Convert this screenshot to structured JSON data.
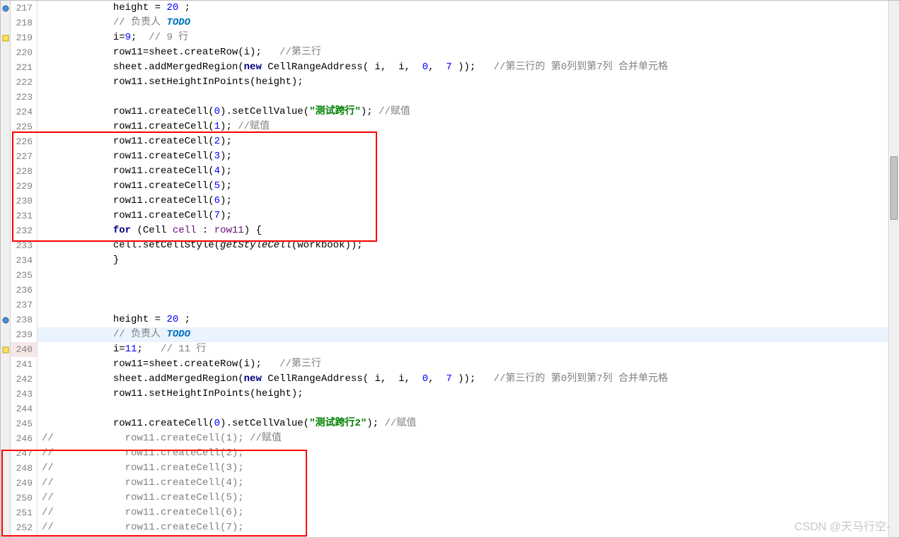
{
  "watermark": "CSDN @天马行空-",
  "lines": [
    {
      "num": "217",
      "marker": "blue",
      "hl": false,
      "cur": false,
      "tokens": [
        {
          "t": "            height = ",
          "c": "c-default"
        },
        {
          "t": "20",
          "c": "c-num"
        },
        {
          "t": " ;",
          "c": "c-default"
        }
      ]
    },
    {
      "num": "218",
      "marker": "none",
      "hl": false,
      "cur": false,
      "tokens": [
        {
          "t": "            ",
          "c": "c-default"
        },
        {
          "t": "// 负责人 ",
          "c": "c-comment"
        },
        {
          "t": "TODO",
          "c": "c-comment-kw"
        }
      ]
    },
    {
      "num": "219",
      "marker": "yellow",
      "hl": false,
      "cur": false,
      "tokens": [
        {
          "t": "            i=",
          "c": "c-default"
        },
        {
          "t": "9",
          "c": "c-num"
        },
        {
          "t": ";  ",
          "c": "c-default"
        },
        {
          "t": "// 9 行",
          "c": "c-comment"
        }
      ]
    },
    {
      "num": "220",
      "marker": "none",
      "hl": false,
      "cur": false,
      "tokens": [
        {
          "t": "            row11=sheet.createRow(i);   ",
          "c": "c-default"
        },
        {
          "t": "//第三行",
          "c": "c-comment"
        }
      ]
    },
    {
      "num": "221",
      "marker": "none",
      "hl": false,
      "cur": false,
      "tokens": [
        {
          "t": "            sheet.addMergedRegion(",
          "c": "c-default"
        },
        {
          "t": "new",
          "c": "c-kw"
        },
        {
          "t": " CellRangeAddress( i,  i,  ",
          "c": "c-default"
        },
        {
          "t": "0",
          "c": "c-num"
        },
        {
          "t": ",  ",
          "c": "c-default"
        },
        {
          "t": "7",
          "c": "c-num"
        },
        {
          "t": " ));   ",
          "c": "c-default"
        },
        {
          "t": "//第三行的 第0列到第7列 合并单元格",
          "c": "c-comment"
        }
      ]
    },
    {
      "num": "222",
      "marker": "none",
      "hl": false,
      "cur": false,
      "tokens": [
        {
          "t": "            row11.setHeightInPoints(height);",
          "c": "c-default"
        }
      ]
    },
    {
      "num": "223",
      "marker": "none",
      "hl": false,
      "cur": false,
      "tokens": [
        {
          "t": "",
          "c": "c-default"
        }
      ]
    },
    {
      "num": "224",
      "marker": "none",
      "hl": false,
      "cur": false,
      "tokens": [
        {
          "t": "            row11.createCell(",
          "c": "c-default"
        },
        {
          "t": "0",
          "c": "c-num"
        },
        {
          "t": ").setCellValue(",
          "c": "c-default"
        },
        {
          "t": "\"测试跨行\"",
          "c": "c-string"
        },
        {
          "t": "); ",
          "c": "c-default"
        },
        {
          "t": "//赋值",
          "c": "c-comment"
        }
      ]
    },
    {
      "num": "225",
      "marker": "none",
      "hl": false,
      "cur": false,
      "tokens": [
        {
          "t": "            row11.createCell(",
          "c": "c-default"
        },
        {
          "t": "1",
          "c": "c-num"
        },
        {
          "t": "); ",
          "c": "c-default"
        },
        {
          "t": "//赋值",
          "c": "c-comment"
        }
      ]
    },
    {
      "num": "226",
      "marker": "none",
      "hl": false,
      "cur": false,
      "tokens": [
        {
          "t": "            row11.createCell(",
          "c": "c-default"
        },
        {
          "t": "2",
          "c": "c-num"
        },
        {
          "t": ");",
          "c": "c-default"
        }
      ]
    },
    {
      "num": "227",
      "marker": "none",
      "hl": false,
      "cur": false,
      "tokens": [
        {
          "t": "            row11.createCell(",
          "c": "c-default"
        },
        {
          "t": "3",
          "c": "c-num"
        },
        {
          "t": ");",
          "c": "c-default"
        }
      ]
    },
    {
      "num": "228",
      "marker": "none",
      "hl": false,
      "cur": false,
      "tokens": [
        {
          "t": "            row11.createCell(",
          "c": "c-default"
        },
        {
          "t": "4",
          "c": "c-num"
        },
        {
          "t": ");",
          "c": "c-default"
        }
      ]
    },
    {
      "num": "229",
      "marker": "none",
      "hl": false,
      "cur": false,
      "tokens": [
        {
          "t": "            row11.createCell(",
          "c": "c-default"
        },
        {
          "t": "5",
          "c": "c-num"
        },
        {
          "t": ");",
          "c": "c-default"
        }
      ]
    },
    {
      "num": "230",
      "marker": "none",
      "hl": false,
      "cur": false,
      "tokens": [
        {
          "t": "            row11.createCell(",
          "c": "c-default"
        },
        {
          "t": "6",
          "c": "c-num"
        },
        {
          "t": ");",
          "c": "c-default"
        }
      ]
    },
    {
      "num": "231",
      "marker": "none",
      "hl": false,
      "cur": false,
      "tokens": [
        {
          "t": "            row11.createCell(",
          "c": "c-default"
        },
        {
          "t": "7",
          "c": "c-num"
        },
        {
          "t": ");",
          "c": "c-default"
        }
      ]
    },
    {
      "num": "232",
      "marker": "none",
      "hl": false,
      "cur": false,
      "tokens": [
        {
          "t": "            ",
          "c": "c-default"
        },
        {
          "t": "for",
          "c": "c-kw"
        },
        {
          "t": " (Cell ",
          "c": "c-default"
        },
        {
          "t": "cell",
          "c": "c-field"
        },
        {
          "t": " : ",
          "c": "c-default"
        },
        {
          "t": "row11",
          "c": "c-field"
        },
        {
          "t": ") {",
          "c": "c-default"
        }
      ]
    },
    {
      "num": "233",
      "marker": "none",
      "hl": false,
      "cur": false,
      "tokens": [
        {
          "t": "            cell.setCellStyle(",
          "c": "c-default"
        },
        {
          "t": "getStyleCell",
          "c": "c-method-italic"
        },
        {
          "t": "(workbook));",
          "c": "c-default"
        }
      ]
    },
    {
      "num": "234",
      "marker": "none",
      "hl": false,
      "cur": false,
      "tokens": [
        {
          "t": "            }",
          "c": "c-default"
        }
      ]
    },
    {
      "num": "235",
      "marker": "none",
      "hl": false,
      "cur": false,
      "tokens": [
        {
          "t": "",
          "c": "c-default"
        }
      ]
    },
    {
      "num": "236",
      "marker": "none",
      "hl": false,
      "cur": false,
      "tokens": [
        {
          "t": "",
          "c": "c-default"
        }
      ]
    },
    {
      "num": "237",
      "marker": "none",
      "hl": false,
      "cur": false,
      "tokens": [
        {
          "t": "",
          "c": "c-default"
        }
      ]
    },
    {
      "num": "238",
      "marker": "blue",
      "hl": false,
      "cur": false,
      "tokens": [
        {
          "t": "            height = ",
          "c": "c-default"
        },
        {
          "t": "20",
          "c": "c-num"
        },
        {
          "t": " ;",
          "c": "c-default"
        }
      ]
    },
    {
      "num": "239",
      "marker": "none",
      "hl": true,
      "cur": false,
      "tokens": [
        {
          "t": "            ",
          "c": "c-default"
        },
        {
          "t": "// 负责人 ",
          "c": "c-comment"
        },
        {
          "t": "TODO",
          "c": "c-comment-kw"
        }
      ]
    },
    {
      "num": "240",
      "marker": "yellow",
      "hl": false,
      "cur": true,
      "tokens": [
        {
          "t": "            i=",
          "c": "c-default"
        },
        {
          "t": "11",
          "c": "c-num"
        },
        {
          "t": ";   ",
          "c": "c-default"
        },
        {
          "t": "// 11 行",
          "c": "c-comment"
        }
      ]
    },
    {
      "num": "241",
      "marker": "none",
      "hl": false,
      "cur": false,
      "tokens": [
        {
          "t": "            row11=sheet.createRow(i);   ",
          "c": "c-default"
        },
        {
          "t": "//第三行",
          "c": "c-comment"
        }
      ]
    },
    {
      "num": "242",
      "marker": "none",
      "hl": false,
      "cur": false,
      "tokens": [
        {
          "t": "            sheet.addMergedRegion(",
          "c": "c-default"
        },
        {
          "t": "new",
          "c": "c-kw"
        },
        {
          "t": " CellRangeAddress( i,  i,  ",
          "c": "c-default"
        },
        {
          "t": "0",
          "c": "c-num"
        },
        {
          "t": ",  ",
          "c": "c-default"
        },
        {
          "t": "7",
          "c": "c-num"
        },
        {
          "t": " ));   ",
          "c": "c-default"
        },
        {
          "t": "//第三行的 第0列到第7列 合并单元格",
          "c": "c-comment"
        }
      ]
    },
    {
      "num": "243",
      "marker": "none",
      "hl": false,
      "cur": false,
      "tokens": [
        {
          "t": "            row11.setHeightInPoints(height);",
          "c": "c-default"
        }
      ]
    },
    {
      "num": "244",
      "marker": "none",
      "hl": false,
      "cur": false,
      "tokens": [
        {
          "t": "",
          "c": "c-default"
        }
      ]
    },
    {
      "num": "245",
      "marker": "none",
      "hl": false,
      "cur": false,
      "tokens": [
        {
          "t": "            row11.createCell(",
          "c": "c-default"
        },
        {
          "t": "0",
          "c": "c-num"
        },
        {
          "t": ").setCellValue(",
          "c": "c-default"
        },
        {
          "t": "\"测试跨行2\"",
          "c": "c-string"
        },
        {
          "t": "); ",
          "c": "c-default"
        },
        {
          "t": "//赋值",
          "c": "c-comment"
        }
      ]
    },
    {
      "num": "246",
      "marker": "none",
      "hl": false,
      "cur": false,
      "tokens": [
        {
          "t": "//            row11.createCell(1); //赋值",
          "c": "c-comment"
        }
      ]
    },
    {
      "num": "247",
      "marker": "none",
      "hl": false,
      "cur": false,
      "tokens": [
        {
          "t": "//            row11.createCell(2);",
          "c": "c-comment"
        }
      ]
    },
    {
      "num": "248",
      "marker": "none",
      "hl": false,
      "cur": false,
      "tokens": [
        {
          "t": "//            row11.createCell(3);",
          "c": "c-comment"
        }
      ]
    },
    {
      "num": "249",
      "marker": "none",
      "hl": false,
      "cur": false,
      "tokens": [
        {
          "t": "//            row11.createCell(4);",
          "c": "c-comment"
        }
      ]
    },
    {
      "num": "250",
      "marker": "none",
      "hl": false,
      "cur": false,
      "tokens": [
        {
          "t": "//            row11.createCell(5);",
          "c": "c-comment"
        }
      ]
    },
    {
      "num": "251",
      "marker": "none",
      "hl": false,
      "cur": false,
      "tokens": [
        {
          "t": "//            row11.createCell(6);",
          "c": "c-comment"
        }
      ]
    },
    {
      "num": "252",
      "marker": "none",
      "hl": false,
      "cur": false,
      "tokens": [
        {
          "t": "//            row11.createCell(7);",
          "c": "c-comment"
        }
      ]
    }
  ]
}
